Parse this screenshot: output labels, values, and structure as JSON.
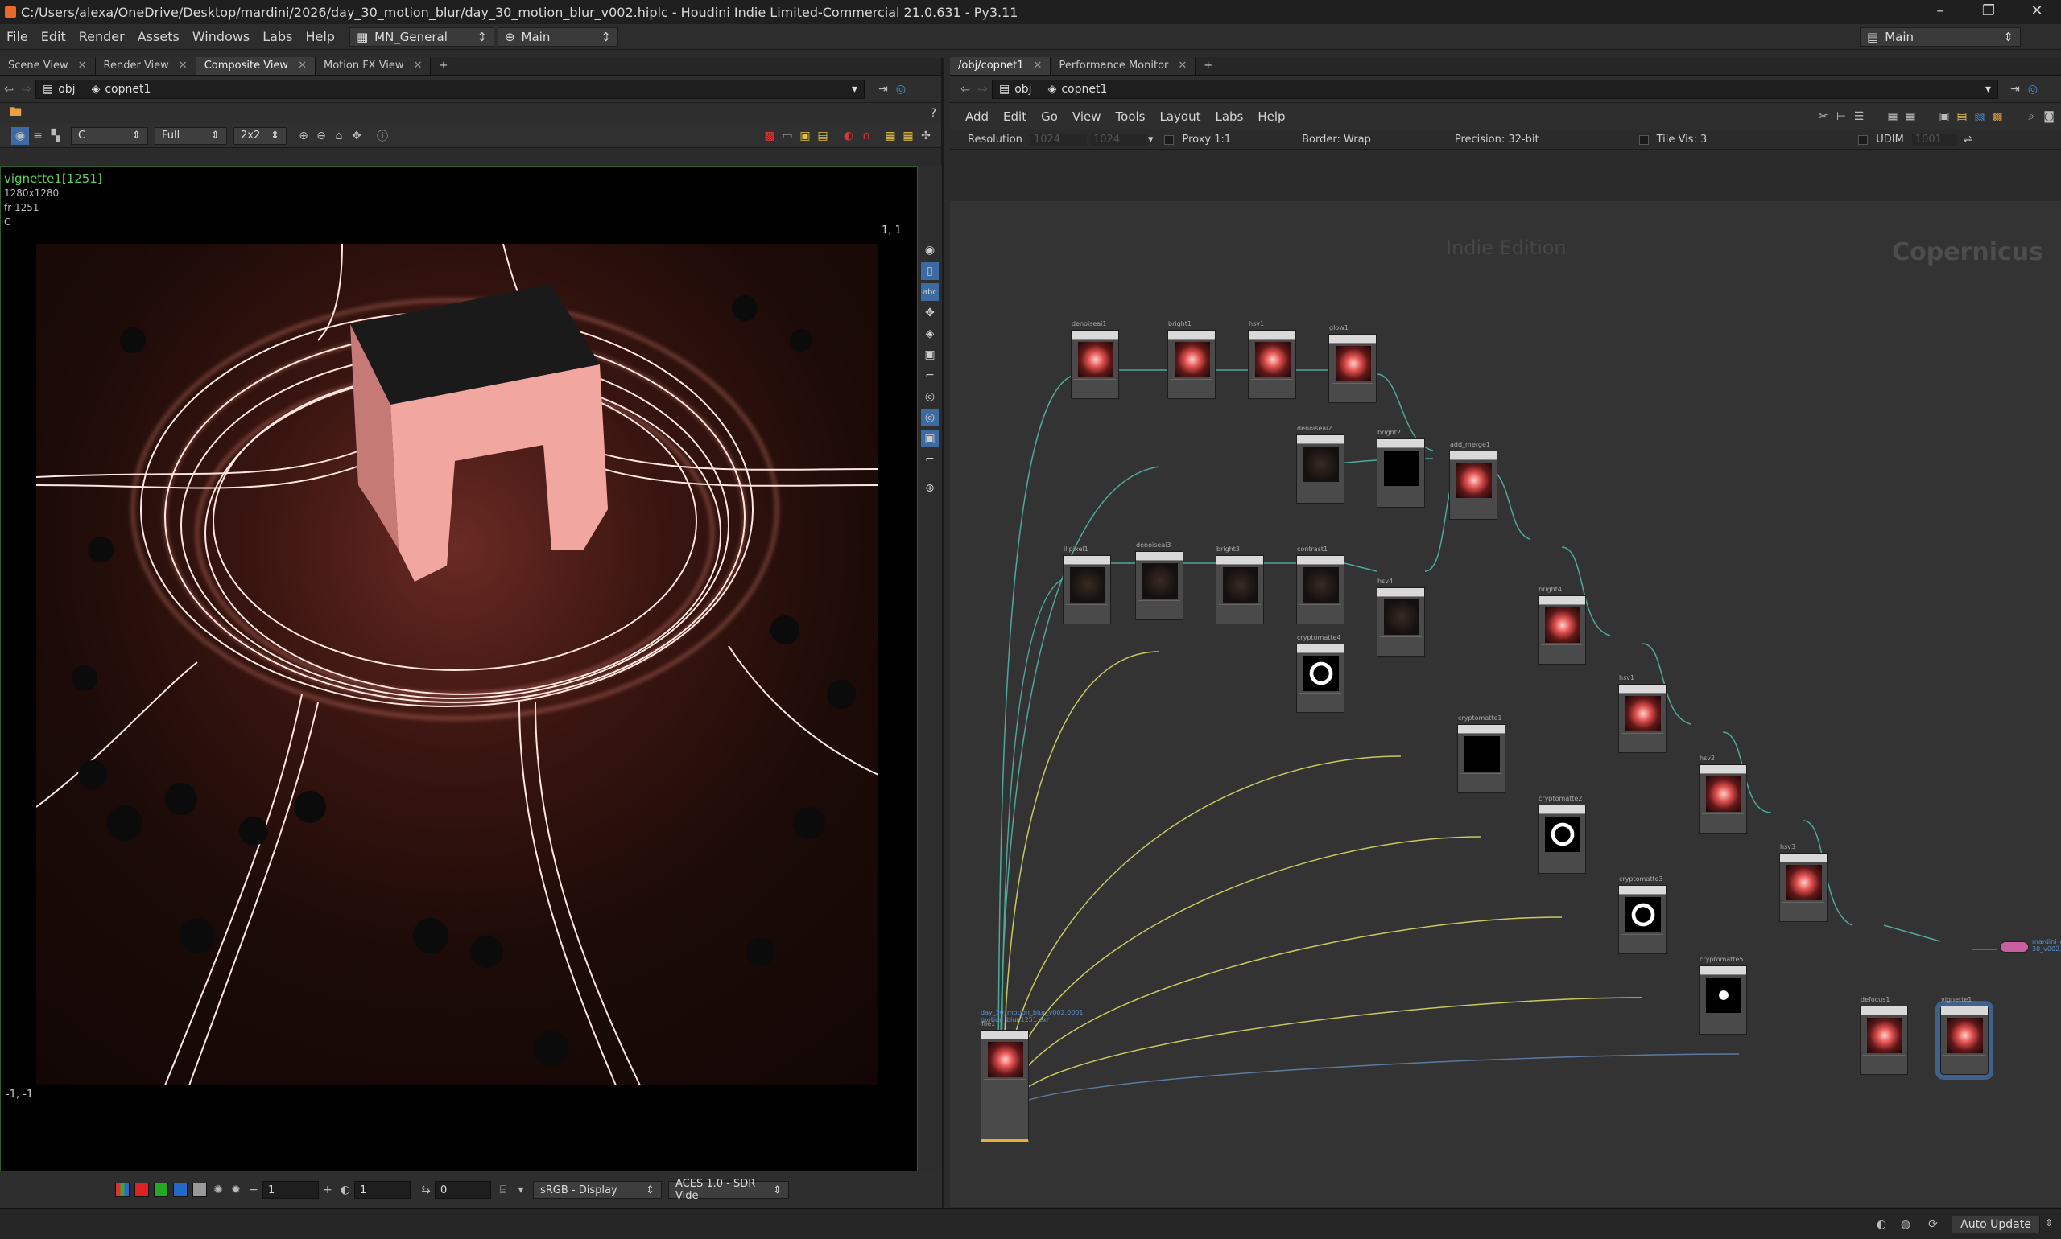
{
  "window": {
    "title": "C:/Users/alexa/OneDrive/Desktop/mardini/2026/day_30_motion_blur/day_30_motion_blur_v002.hiplc - Houdini Indie Limited-Commercial 21.0.631 - Py3.11",
    "minimize": "–",
    "maximize": "❐",
    "close": "✕"
  },
  "menubar": {
    "items": [
      "File",
      "Edit",
      "Render",
      "Assets",
      "Windows",
      "Labs",
      "Help"
    ],
    "desktop": "MN_General",
    "context": "Main",
    "right_desktop": "Main"
  },
  "left_pane": {
    "tabs": [
      "Scene View",
      "Render View",
      "Composite View",
      "Motion FX View"
    ],
    "path": {
      "obj": "obj",
      "node": "copnet1"
    },
    "toolbar": {
      "channel": "C",
      "res": "Full",
      "tile": "2x2"
    },
    "viewer": {
      "node_label": "vignette1[1251]",
      "resolution": "1280x1280",
      "frame": "fr 1251",
      "channel": "C",
      "coord_top": "1, 1",
      "coord_bottom": "-1, -1"
    },
    "bottom": {
      "value1": "1",
      "value2": "1",
      "value3": "0",
      "colorspace": "sRGB - Display",
      "view_transform": "ACES 1.0 - SDR Vide"
    }
  },
  "right_pane": {
    "tabs": [
      "/obj/copnet1",
      "Performance Monitor"
    ],
    "path": {
      "obj": "obj",
      "node": "copnet1"
    },
    "menu": [
      "Add",
      "Edit",
      "Go",
      "View",
      "Tools",
      "Layout",
      "Labs",
      "Help"
    ],
    "params": {
      "resolution_label": "Resolution",
      "res_x": "1024",
      "res_y": "1024",
      "proxy": "Proxy 1:1",
      "border": "Border: Wrap",
      "precision": "Precision: 32-bit",
      "tile_vis": "Tile Vis: 3",
      "udim": "UDIM",
      "udim_val": "1001"
    },
    "watermark": "Indie Edition",
    "context_label": "Copernicus",
    "nodes": [
      {
        "name": "denoiseai1",
        "kind": "glow"
      },
      {
        "name": "bright1",
        "kind": "glow"
      },
      {
        "name": "hsv1",
        "kind": "glow"
      },
      {
        "name": "glow1",
        "kind": "glow"
      },
      {
        "name": "denoiseai2",
        "kind": "dark"
      },
      {
        "name": "bright2",
        "kind": "black"
      },
      {
        "name": "add_merge1",
        "kind": "glow"
      },
      {
        "name": "illpixel1",
        "kind": "dark"
      },
      {
        "name": "denoiseai3",
        "kind": "dark"
      },
      {
        "name": "bright3",
        "kind": "dark"
      },
      {
        "name": "contrast1",
        "kind": "dark"
      },
      {
        "name": "hsv4",
        "kind": "dark"
      },
      {
        "name": "bright4",
        "kind": "glow"
      },
      {
        "name": "cryptomatte4",
        "kind": "mask"
      },
      {
        "name": "hsv1",
        "kind": "glow"
      },
      {
        "name": "cryptomatte1",
        "kind": "black"
      },
      {
        "name": "hsv2",
        "kind": "glow"
      },
      {
        "name": "cryptomatte2",
        "kind": "mask"
      },
      {
        "name": "hsv3",
        "kind": "glow"
      },
      {
        "name": "cryptomatte3",
        "kind": "mask"
      },
      {
        "name": "cryptomatte5",
        "kind": "mask2"
      },
      {
        "name": "defocus1",
        "kind": "glow"
      },
      {
        "name": "vignette1",
        "kind": "glow"
      },
      {
        "name": "file1",
        "kind": "glow"
      }
    ],
    "file_node_path": "day_30_motion_blur_v002.0001\nmotion_blur.1251.exr",
    "output_label": "mardini_day_\n30_v002.png"
  },
  "statusbar": {
    "auto_update": "Auto Update"
  }
}
